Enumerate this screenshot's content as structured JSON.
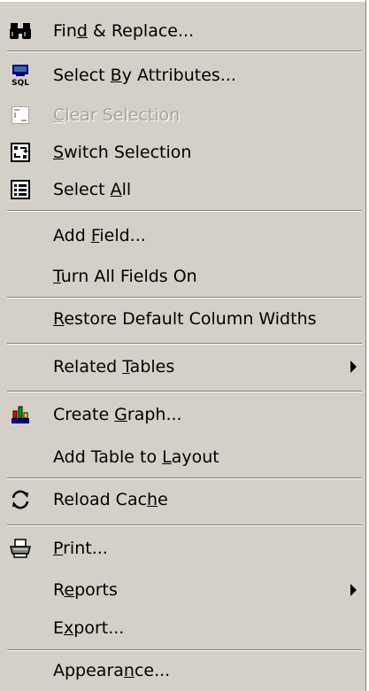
{
  "menu": {
    "items": {
      "find_replace": {
        "pre": "Fin",
        "key": "d",
        "post": " & Replace...",
        "icon": "binoculars-icon"
      },
      "select_by_attributes": {
        "pre": "Select ",
        "key": "B",
        "post": "y Attributes...",
        "icon": "sql-select-icon",
        "icon_text": "SQL"
      },
      "clear_selection": {
        "pre": "",
        "key": "C",
        "post": "lear Selection",
        "icon": "clear-selection-icon"
      },
      "switch_selection": {
        "pre": "",
        "key": "S",
        "post": "witch Selection",
        "icon": "switch-selection-icon"
      },
      "select_all": {
        "pre": "Select ",
        "key": "A",
        "post": "ll",
        "icon": "select-all-icon"
      },
      "add_field": {
        "pre": "Add ",
        "key": "F",
        "post": "ield..."
      },
      "turn_all_fields_on": {
        "pre": "",
        "key": "T",
        "post": "urn All Fields On"
      },
      "restore_default_column_widths": {
        "pre": "",
        "key": "R",
        "post": "estore Default Column Widths"
      },
      "related_tables": {
        "pre": "Related ",
        "key": "T",
        "post": "ables"
      },
      "create_graph": {
        "pre": "Create ",
        "key": "G",
        "post": "raph...",
        "icon": "graph-icon"
      },
      "add_table_to_layout": {
        "pre": "Add Table to ",
        "key": "L",
        "post": "ayout"
      },
      "reload_cache": {
        "pre": "Reload Cac",
        "key": "h",
        "post": "e",
        "icon": "reload-icon"
      },
      "print": {
        "pre": "",
        "key": "P",
        "post": "rint...",
        "icon": "printer-icon"
      },
      "reports": {
        "pre": "R",
        "key": "e",
        "post": "ports"
      },
      "export": {
        "pre": "E",
        "key": "x",
        "post": "port..."
      },
      "appearance": {
        "pre": "Appeara",
        "key": "n",
        "post": "ce..."
      }
    }
  },
  "colors": {
    "menu_background": "#d4d0c8",
    "disabled_text": "#a6a39c",
    "separator_dark": "#808080",
    "separator_light": "#ffffff"
  }
}
